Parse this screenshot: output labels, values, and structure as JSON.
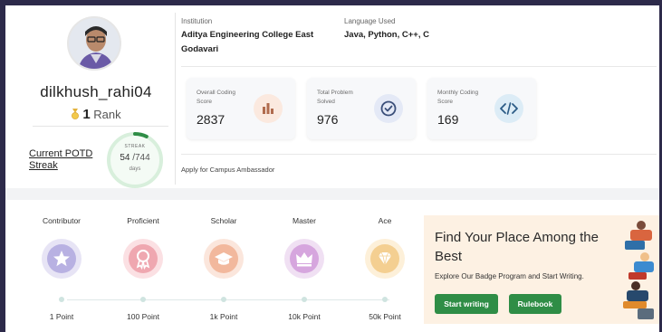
{
  "profile": {
    "username": "dilkhush_rahi04",
    "rank_value": "1",
    "rank_label": "Rank",
    "potd_label": "Current POTD Streak",
    "streak_label": "STREAK",
    "streak_current": "54",
    "streak_total": "/744",
    "streak_unit": "days",
    "streak_progress": 0.0726
  },
  "info": {
    "institution_label": "Institution",
    "institution_value": "Aditya Engineering College East Godavari",
    "language_label": "Language Used",
    "language_value": "Java, Python, C++, C"
  },
  "stats": [
    {
      "title": "Overall Coding Score",
      "value": "2837",
      "icon": "bar-chart-icon",
      "icon_bg": "#fbe9df",
      "icon_color": "#b06b4e"
    },
    {
      "title": "Total Problem Solved",
      "value": "976",
      "icon": "check-circle-icon",
      "icon_bg": "#e4e9f6",
      "icon_color": "#3b4f7a"
    },
    {
      "title": "Monthly Coding Score",
      "value": "169",
      "icon": "code-icon",
      "icon_bg": "#dcecf6",
      "icon_color": "#2b5b86"
    }
  ],
  "ambassador_text": "Apply for Campus Ambassador",
  "badges": [
    {
      "name": "Contributor",
      "points": "1 Point",
      "icon": "star-icon",
      "outer": "#e7e4f5",
      "inner": "#b8b1e2"
    },
    {
      "name": "Proficient",
      "points": "100 Point",
      "icon": "ribbon-icon",
      "outer": "#fbe0e3",
      "inner": "#efa7b0"
    },
    {
      "name": "Scholar",
      "points": "1k Point",
      "icon": "graduation-cap-icon",
      "outer": "#fbe6dc",
      "inner": "#f2b89d"
    },
    {
      "name": "Master",
      "points": "10k Point",
      "icon": "crown-icon",
      "outer": "#f0e0f3",
      "inner": "#d6a6de"
    },
    {
      "name": "Ace",
      "points": "50k Point",
      "icon": "diamond-icon",
      "outer": "#fdf0d9",
      "inner": "#f4cf91"
    }
  ],
  "promo": {
    "title": "Find Your Place Among the Best",
    "description": "Explore Our Badge Program and Start Writing.",
    "start_label": "Start writing",
    "rulebook_label": "Rulebook"
  },
  "colors": {
    "accent_green": "#2f8d46",
    "ring_green": "#2f8d46"
  }
}
